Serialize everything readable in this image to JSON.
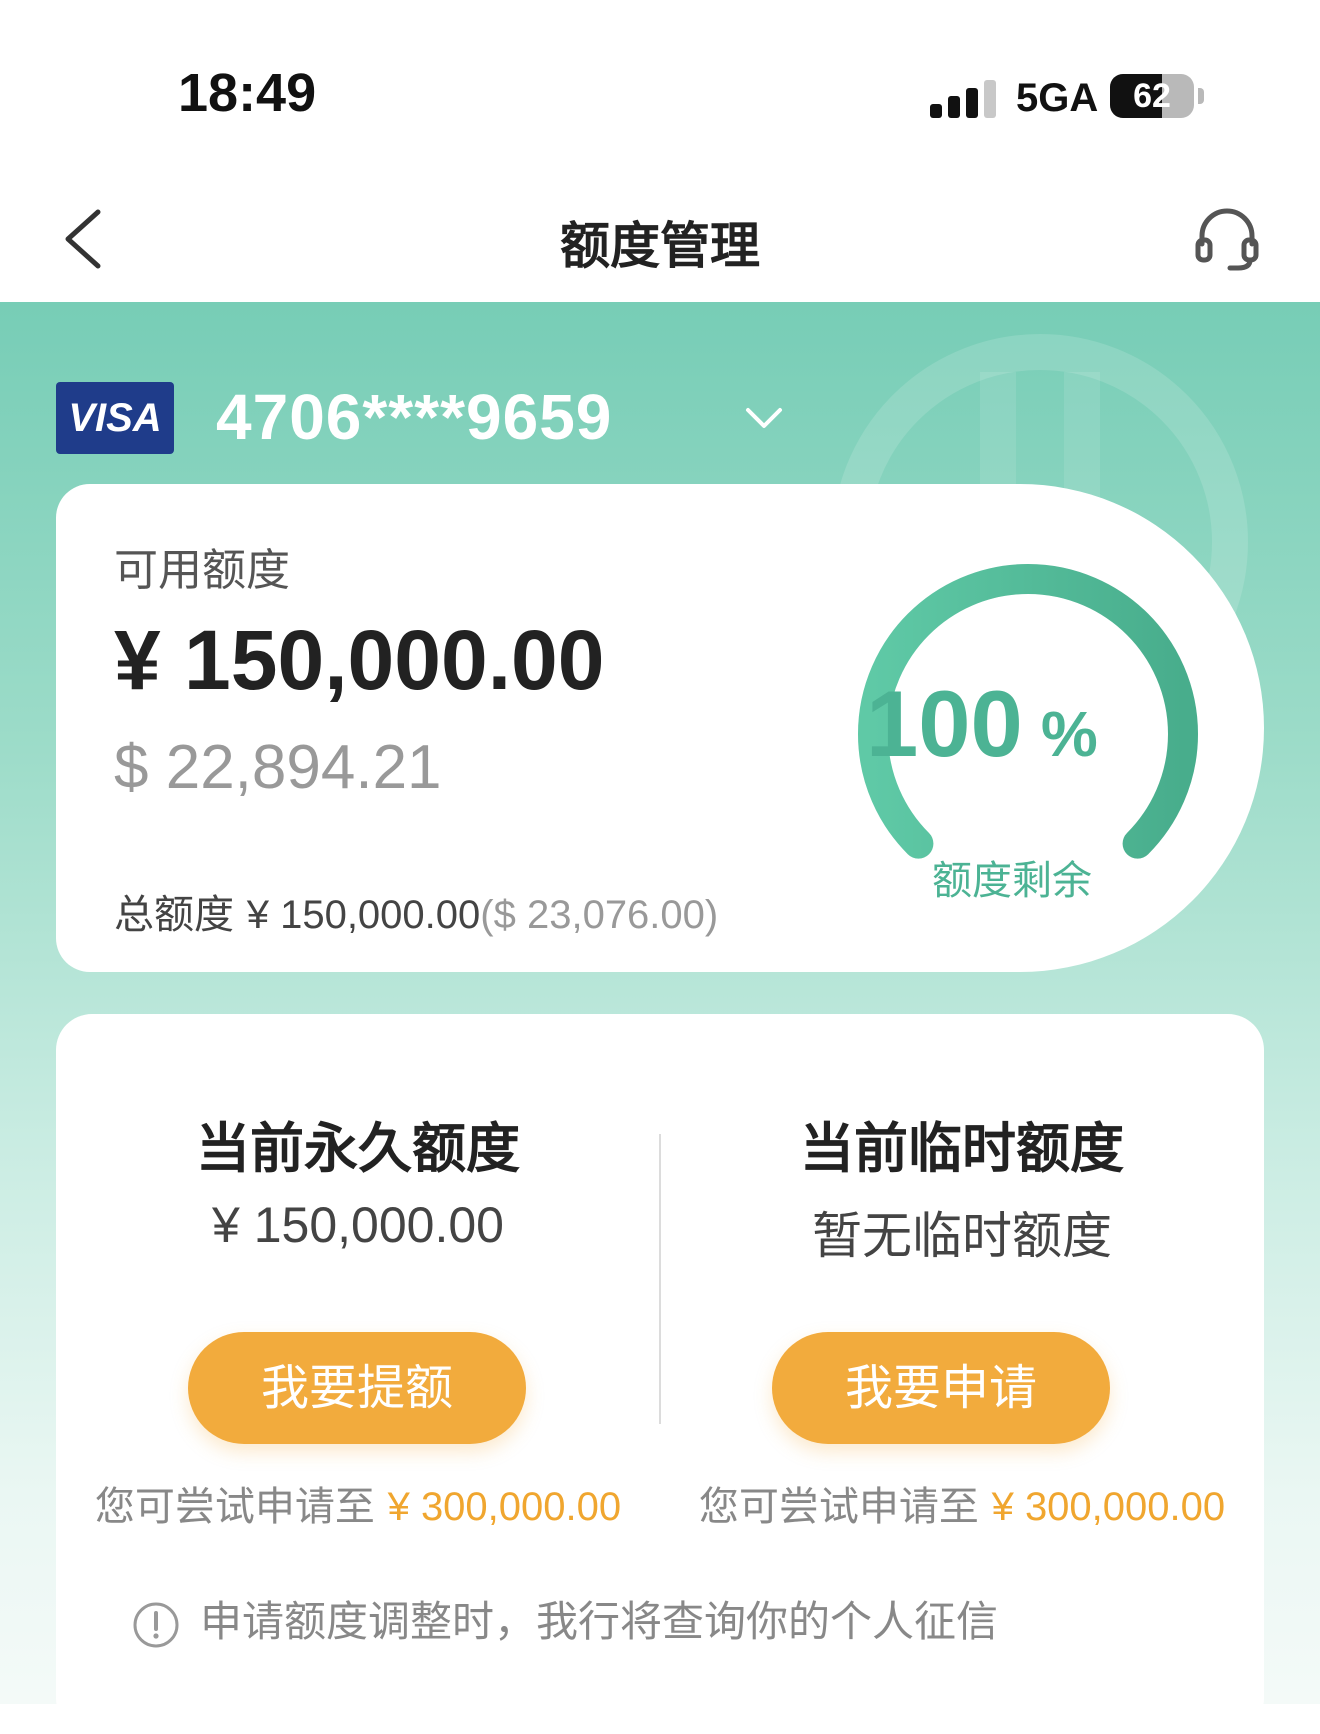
{
  "status_bar": {
    "time": "18:49",
    "network": "5GA",
    "battery_level": 62,
    "battery_text": "62"
  },
  "nav": {
    "title": "额度管理",
    "back_icon": "chevron-left-icon",
    "service_icon": "headset-icon"
  },
  "card": {
    "brand": "VISA",
    "number": "4706****9659"
  },
  "available": {
    "label": "可用额度",
    "cny": "¥ 150,000.00",
    "usd": "$ 22,894.21",
    "total_label": "总额度",
    "total_cny": "¥ 150,000.00",
    "total_usd": "($ 23,076.00)",
    "percent_remaining": 100,
    "percent_text": "100",
    "percent_sign": "%",
    "gauge_label": "额度剩余"
  },
  "permanent": {
    "title": "当前永久额度",
    "value": "¥ 150,000.00",
    "button": "我要提额",
    "hint_prefix": "您可尝试申请至",
    "hint_amount": "¥ 300,000.00"
  },
  "temporary": {
    "title": "当前临时额度",
    "value": "暂无临时额度",
    "button": "我要申请",
    "hint_prefix": "您可尝试申请至",
    "hint_amount": "¥ 300,000.00"
  },
  "notice": {
    "text": "申请额度调整时，我行将查询你的个人征信",
    "icon": "info-icon"
  },
  "colors": {
    "accent": "#4cb394",
    "button": "#f2ab3d",
    "hint_amount": "#f0a62f",
    "visa": "#1f3c8a"
  }
}
